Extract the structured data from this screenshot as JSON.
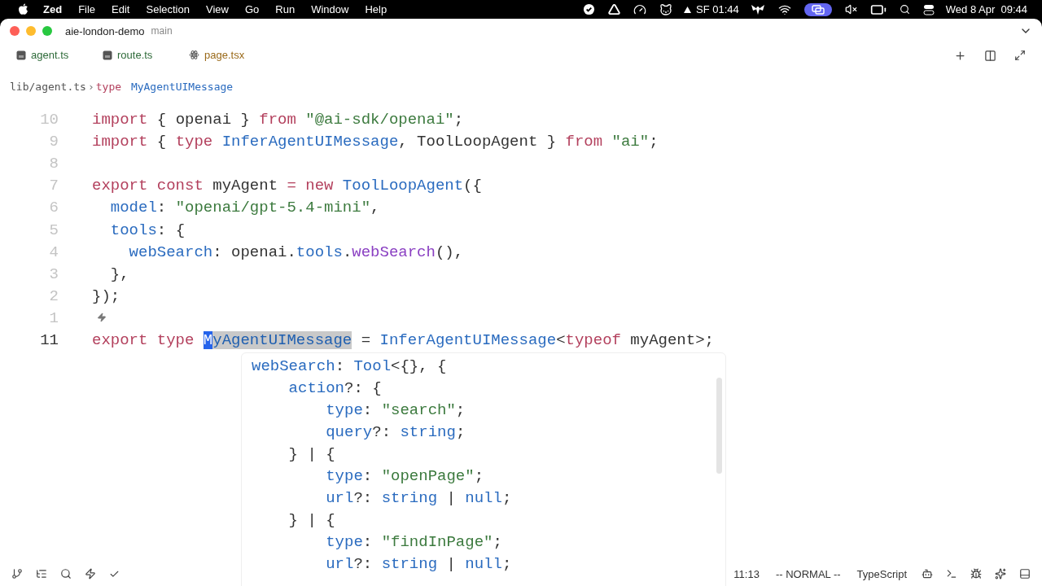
{
  "menubar": {
    "app": "Zed",
    "menus": [
      "File",
      "Edit",
      "Selection",
      "View",
      "Go",
      "Run",
      "Window",
      "Help"
    ],
    "network": "SF 01:44",
    "clock": "Wed 8 Apr  09:44"
  },
  "window": {
    "project": "aie-london-demo",
    "branch": "main"
  },
  "tabs": [
    {
      "label": "agent.ts",
      "kind": "ts",
      "color": "#2f6b3a"
    },
    {
      "label": "route.ts",
      "kind": "ts",
      "color": "#2f6b3a"
    },
    {
      "label": "page.tsx",
      "kind": "react",
      "color": "#9a6a1a"
    }
  ],
  "breadcrumb": {
    "file": "lib/agent.ts",
    "separator": "›",
    "symbol_kind": "type",
    "symbol": "MyAgentUIMessage"
  },
  "code_lines": [
    {
      "number": "10",
      "current": false,
      "code_action": false,
      "tokens": [
        {
          "text": "import",
          "kind": "kw"
        },
        {
          "text": " { openai } ",
          "kind": "plain"
        },
        {
          "text": "from",
          "kind": "kw"
        },
        {
          "text": " \"@ai-sdk/openai\"",
          "kind": "str"
        },
        {
          "text": ";",
          "kind": "plain"
        }
      ]
    },
    {
      "number": "9",
      "current": false,
      "code_action": false,
      "tokens": [
        {
          "text": "import",
          "kind": "kw"
        },
        {
          "text": " { ",
          "kind": "plain"
        },
        {
          "text": "type",
          "kind": "kw"
        },
        {
          "text": " InferAgentUIMessage",
          "kind": "type"
        },
        {
          "text": ", ToolLoopAgent } ",
          "kind": "plain"
        },
        {
          "text": "from",
          "kind": "kw"
        },
        {
          "text": " \"ai\"",
          "kind": "str"
        },
        {
          "text": ";",
          "kind": "plain"
        }
      ]
    },
    {
      "number": "8",
      "current": false,
      "code_action": false
    },
    {
      "number": "7",
      "current": false,
      "code_action": false,
      "tokens": [
        {
          "text": "export const",
          "kind": "kw"
        },
        {
          "text": " myAgent ",
          "kind": "plain"
        },
        {
          "text": "= new",
          "kind": "kw"
        },
        {
          "text": " ToolLoopAgent",
          "kind": "type"
        },
        {
          "text": "({",
          "kind": "plain"
        }
      ]
    },
    {
      "number": "6",
      "current": false,
      "code_action": false,
      "tokens": [
        {
          "text": "  model",
          "kind": "prop"
        },
        {
          "text": ": ",
          "kind": "plain"
        },
        {
          "text": "\"openai/gpt-5.4-mini\"",
          "kind": "str"
        },
        {
          "text": ",",
          "kind": "plain"
        }
      ]
    },
    {
      "number": "5",
      "current": false,
      "code_action": false,
      "tokens": [
        {
          "text": "  tools",
          "kind": "prop"
        },
        {
          "text": ": {",
          "kind": "plain"
        }
      ]
    },
    {
      "number": "4",
      "current": false,
      "code_action": false,
      "tokens": [
        {
          "text": "    webSearch",
          "kind": "prop"
        },
        {
          "text": ": openai.",
          "kind": "plain"
        },
        {
          "text": "tools",
          "kind": "prop"
        },
        {
          "text": ".",
          "kind": "plain"
        },
        {
          "text": "webSearch",
          "kind": "func"
        },
        {
          "text": "(),",
          "kind": "plain"
        }
      ]
    },
    {
      "number": "3",
      "current": false,
      "code_action": false,
      "tokens": [
        {
          "text": "  },",
          "kind": "plain"
        }
      ]
    },
    {
      "number": "2",
      "current": false,
      "code_action": false,
      "tokens": [
        {
          "text": "});",
          "kind": "plain"
        }
      ]
    },
    {
      "number": "1",
      "current": false,
      "code_action": true
    },
    {
      "number": "11",
      "current": true,
      "code_action": false,
      "tokens": [
        {
          "text": "export type ",
          "kind": "kw"
        },
        {
          "text": "M",
          "kind": "cursor"
        },
        {
          "text": "yAgentUIMessage",
          "kind": "selection"
        },
        {
          "text": " = ",
          "kind": "plain"
        },
        {
          "text": "InferAgentUIMessage",
          "kind": "type"
        },
        {
          "text": "<",
          "kind": "plain"
        },
        {
          "text": "typeof",
          "kind": "kw"
        },
        {
          "text": " myAgent>;",
          "kind": "plain"
        }
      ]
    }
  ],
  "hover_popup": {
    "lines": [
      [
        {
          "text": "webSearch",
          "kind": "prop"
        },
        {
          "text": ": ",
          "kind": "plain"
        },
        {
          "text": "Tool",
          "kind": "type"
        },
        {
          "text": "<{}, {",
          "kind": "plain"
        }
      ],
      [
        {
          "text": "    action",
          "kind": "prop"
        },
        {
          "text": "?: {",
          "kind": "plain"
        }
      ],
      [
        {
          "text": "        type",
          "kind": "prop"
        },
        {
          "text": ": ",
          "kind": "plain"
        },
        {
          "text": "\"search\"",
          "kind": "str"
        },
        {
          "text": ";",
          "kind": "plain"
        }
      ],
      [
        {
          "text": "        query",
          "kind": "prop"
        },
        {
          "text": "?: ",
          "kind": "plain"
        },
        {
          "text": "string",
          "kind": "type"
        },
        {
          "text": ";",
          "kind": "plain"
        }
      ],
      [
        {
          "text": "    } | {",
          "kind": "plain"
        }
      ],
      [
        {
          "text": "        type",
          "kind": "prop"
        },
        {
          "text": ": ",
          "kind": "plain"
        },
        {
          "text": "\"openPage\"",
          "kind": "str"
        },
        {
          "text": ";",
          "kind": "plain"
        }
      ],
      [
        {
          "text": "        url",
          "kind": "prop"
        },
        {
          "text": "?: ",
          "kind": "plain"
        },
        {
          "text": "string",
          "kind": "type"
        },
        {
          "text": " | ",
          "kind": "plain"
        },
        {
          "text": "null",
          "kind": "type"
        },
        {
          "text": ";",
          "kind": "plain"
        }
      ],
      [
        {
          "text": "    } | {",
          "kind": "plain"
        }
      ],
      [
        {
          "text": "        type",
          "kind": "prop"
        },
        {
          "text": ": ",
          "kind": "plain"
        },
        {
          "text": "\"findInPage\"",
          "kind": "str"
        },
        {
          "text": ";",
          "kind": "plain"
        }
      ],
      [
        {
          "text": "        url",
          "kind": "prop"
        },
        {
          "text": "?: ",
          "kind": "plain"
        },
        {
          "text": "string",
          "kind": "type"
        },
        {
          "text": " | ",
          "kind": "plain"
        },
        {
          "text": "null",
          "kind": "type"
        },
        {
          "text": ";",
          "kind": "plain"
        }
      ]
    ]
  },
  "status_bar": {
    "position": "11:13",
    "mode": "-- NORMAL --",
    "language": "TypeScript"
  }
}
